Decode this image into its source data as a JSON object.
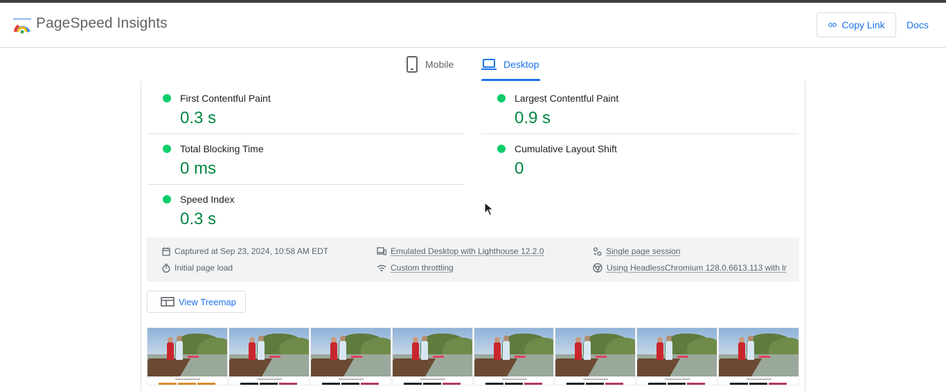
{
  "app": {
    "title": "PageSpeed Insights"
  },
  "header": {
    "copy_link_label": "Copy Link",
    "docs_label": "Docs"
  },
  "tabs": [
    {
      "label": "Mobile",
      "active": false
    },
    {
      "label": "Desktop",
      "active": true
    }
  ],
  "metrics": [
    {
      "name": "First Contentful Paint",
      "value": "0.3 s",
      "status": "good"
    },
    {
      "name": "Largest Contentful Paint",
      "value": "0.9 s",
      "status": "good"
    },
    {
      "name": "Total Blocking Time",
      "value": "0 ms",
      "status": "good"
    },
    {
      "name": "Cumulative Layout Shift",
      "value": "0",
      "status": "good"
    },
    {
      "name": "Speed Index",
      "value": "0.3 s",
      "status": "good"
    }
  ],
  "info": {
    "captured": "Captured at Sep 23, 2024, 10:58 AM EDT",
    "load": "Initial page load",
    "device": "Emulated Desktop with Lighthouse 12.2.0",
    "throttling": "Custom throttling",
    "session": "Single page session",
    "browser": "Using HeadlessChromium 128.0.6613.113 with lr"
  },
  "treemap": {
    "label": "View Treemap"
  },
  "filmstrip": {
    "frame_count": 8
  },
  "colors": {
    "accent": "#1a73e8",
    "good": "#0cce6b",
    "good_text": "#018642",
    "info_bg": "#f1f3f4"
  }
}
